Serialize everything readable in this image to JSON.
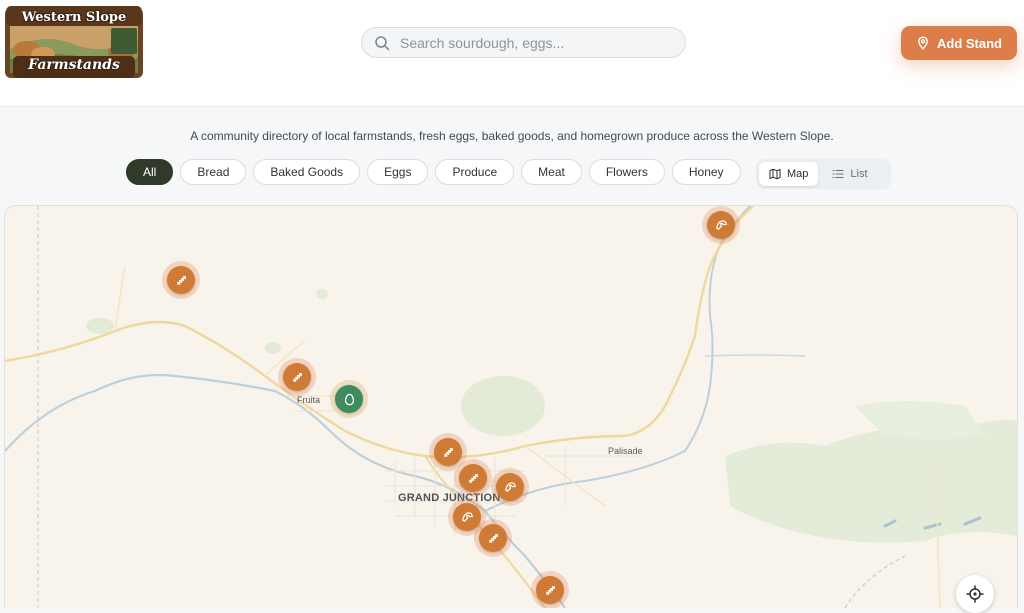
{
  "logo": {
    "line1": "Western Slope",
    "line2": "Farmstands"
  },
  "search": {
    "placeholder": "Search sourdough, eggs..."
  },
  "add_button": {
    "label": "Add Stand",
    "color": "#dd7d4a"
  },
  "tagline": "A community directory of local farmstands, fresh eggs, baked goods, and homegrown produce across the Western Slope.",
  "filters": [
    {
      "label": "All",
      "active": true
    },
    {
      "label": "Bread",
      "active": false
    },
    {
      "label": "Baked Goods",
      "active": false
    },
    {
      "label": "Eggs",
      "active": false
    },
    {
      "label": "Produce",
      "active": false
    },
    {
      "label": "Meat",
      "active": false
    },
    {
      "label": "Flowers",
      "active": false
    },
    {
      "label": "Honey",
      "active": false
    }
  ],
  "view_toggle": {
    "map_label": "Map",
    "list_label": "List",
    "selected": "Map"
  },
  "map": {
    "places": {
      "fruita": "Fruita",
      "palisade": "Palisade",
      "grand_junction": "GRAND JUNCTION"
    },
    "markers": [
      {
        "category": "bread",
        "icon": "wheat-icon"
      },
      {
        "category": "baked-goods",
        "icon": "croissant-icon"
      },
      {
        "category": "bread",
        "icon": "wheat-icon"
      },
      {
        "category": "eggs",
        "icon": "egg-icon"
      },
      {
        "category": "bread",
        "icon": "wheat-icon"
      },
      {
        "category": "bread",
        "icon": "wheat-icon"
      },
      {
        "category": "baked-goods",
        "icon": "croissant-icon"
      },
      {
        "category": "baked-goods",
        "icon": "croissant-icon"
      },
      {
        "category": "bread",
        "icon": "wheat-icon"
      },
      {
        "category": "bread",
        "icon": "wheat-icon"
      }
    ],
    "colors": {
      "marker_bread": "#cf7a35",
      "marker_eggs": "#3f8a5f"
    }
  }
}
